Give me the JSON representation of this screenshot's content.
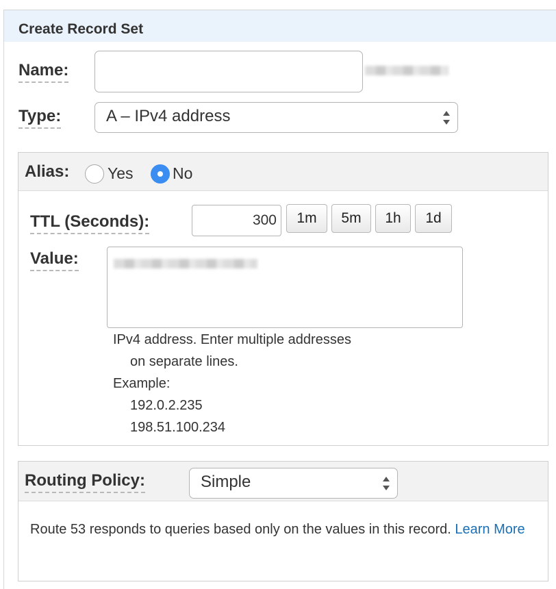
{
  "panel": {
    "title": "Create Record Set"
  },
  "fields": {
    "name_label": "Name:",
    "name_value": "",
    "type_label": "Type:",
    "type_value": "A – IPv4 address"
  },
  "alias": {
    "label": "Alias:",
    "yes_label": "Yes",
    "no_label": "No",
    "selected": "No"
  },
  "ttl": {
    "label": "TTL (Seconds):",
    "value": "300",
    "presets": [
      "1m",
      "5m",
      "1h",
      "1d"
    ]
  },
  "value": {
    "label": "Value:",
    "help_line1": "IPv4 address. Enter multiple addresses",
    "help_line2": "on separate lines.",
    "example_label": "Example:",
    "example1": "192.0.2.235",
    "example2": "198.51.100.234"
  },
  "routing": {
    "label": "Routing Policy:",
    "value": "Simple",
    "description": "Route 53 responds to queries based only on the values in this record.",
    "learn_more": "Learn More"
  },
  "icons": {
    "select_arrows": "updown-arrows-icon"
  }
}
